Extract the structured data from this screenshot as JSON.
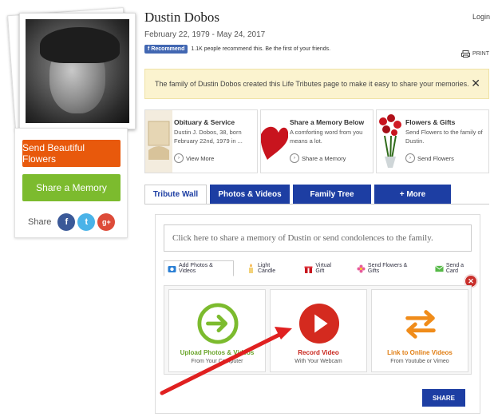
{
  "profile": {
    "name": "Dustin Dobos",
    "dates": "February 22, 1979 - May 24, 2017",
    "recommend_label": "Recommend",
    "recommend_text": "1.1K people recommend this. Be the first of your friends.",
    "login": "Login",
    "print": "PRINT"
  },
  "sidebar": {
    "flowers_button": "Send Beautiful Flowers",
    "memory_button": "Share a Memory",
    "share_label": "Share"
  },
  "banner": {
    "text": "The family of Dustin Dobos created this Life Tributes page to make it easy to share your memories."
  },
  "cards": [
    {
      "title": "Obituary & Service",
      "desc": "Dustin J. Dobos, 38, born February 22nd, 1979 in ...",
      "action": "View More"
    },
    {
      "title": "Share a Memory Below",
      "desc": "A comforting word from you means a lot.",
      "action": "Share a Memory"
    },
    {
      "title": "Flowers & Gifts",
      "desc": "Send Flowers to the family of Dustin.",
      "action": "Send Flowers"
    }
  ],
  "tabs": [
    "Tribute Wall",
    "Photos & Videos",
    "Family Tree",
    "+ More"
  ],
  "composer": {
    "placeholder": "Click here to share a memory of Dustin or send condolences to the family.",
    "subtabs": [
      "Add Photos & Videos",
      "Light Candle",
      "Virtual Gift",
      "Send Flowers & Gifts",
      "Send a Card"
    ],
    "options": [
      {
        "title": "Upload Photos & Videos",
        "subtitle": "From Your Computer"
      },
      {
        "title": "Record Video",
        "subtitle": "With Your Webcam"
      },
      {
        "title": "Link to Online Videos",
        "subtitle": "From Youtube or Vimeo"
      }
    ],
    "share_button": "SHARE"
  },
  "colors": {
    "orange": "#e8590c",
    "green": "#7cbb2e",
    "navy": "#1d3ea3",
    "red": "#d42a1f"
  }
}
